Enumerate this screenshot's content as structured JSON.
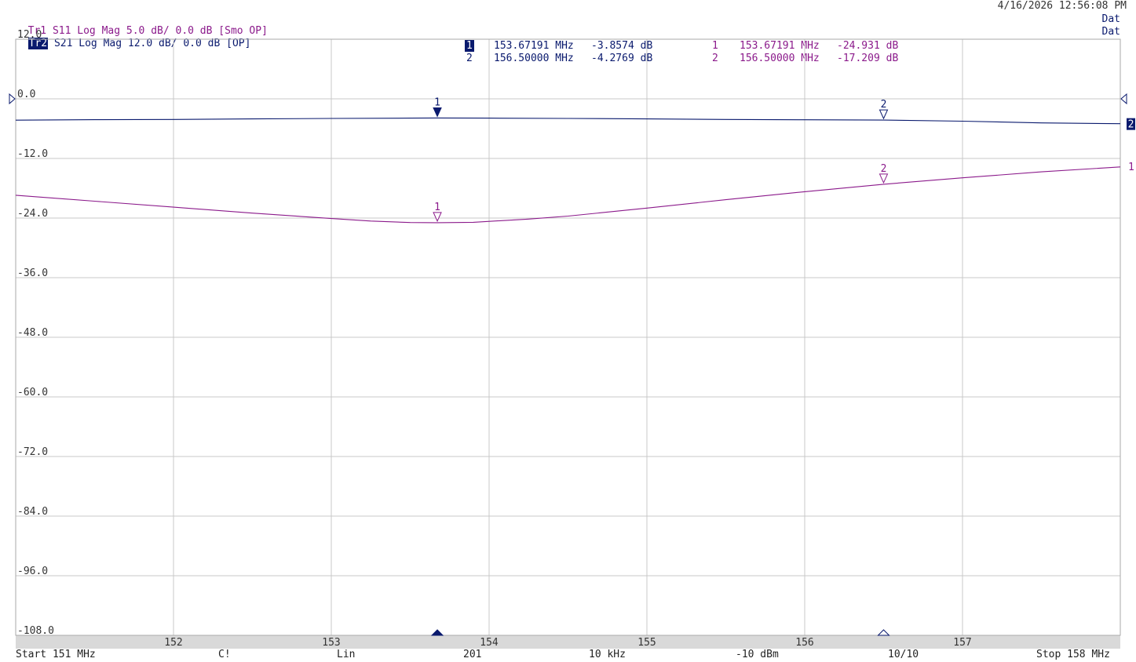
{
  "header": {
    "tr1_label": "Tr1",
    "tr1_text": " S11 Log Mag 5.0 dB/ 0.0 dB [Smo OP]",
    "tr2_label": "Tr2",
    "tr2_text": " S21 Log Mag 12.0 dB/ 0.0 dB [OP]",
    "datetime": "4/16/2026 12:56:08 PM",
    "dat1": "Dat",
    "dat2": "Dat"
  },
  "marker_table": {
    "tr2": [
      {
        "id": "1",
        "freq": "153.67191 MHz",
        "value": "-3.8574 dB"
      },
      {
        "id": "2",
        "freq": "156.50000 MHz",
        "value": "-4.2769 dB"
      }
    ],
    "tr1": [
      {
        "id": "1",
        "freq": "153.67191 MHz",
        "value": "-24.931 dB"
      },
      {
        "id": "2",
        "freq": "156.50000 MHz",
        "value": "-17.209 dB"
      }
    ]
  },
  "footer": {
    "start": "Start 151 MHz",
    "cal": "C!",
    "sweep": "Lin",
    "points": "201",
    "ifbw": "10 kHz",
    "power": "-10 dBm",
    "avg": "10/10",
    "stop": "Stop 158 MHz"
  },
  "colors": {
    "tr1": "#8b1a8b",
    "tr2": "#0a1a6e",
    "grid": "#c8c8c8",
    "axis_band": "#d9d9d9"
  },
  "chart_data": {
    "type": "line",
    "xlim": [
      151,
      158
    ],
    "ylim": [
      -108,
      12
    ],
    "xticks": [
      152,
      153,
      154,
      155,
      156,
      157
    ],
    "yticks": [
      12,
      0,
      -12,
      -24,
      -36,
      -48,
      -60,
      -72,
      -84,
      -96,
      -108
    ],
    "ytick_labels": [
      "12.0",
      "0.0",
      "-12.0",
      "-24.0",
      "-36.0",
      "-48.0",
      "-60.0",
      "-72.0",
      "-84.0",
      "-96.0",
      "-108.0"
    ],
    "grid": true,
    "series": [
      {
        "name": "S21",
        "trace": "Tr2",
        "scale_db_per_div": 12,
        "ref_db": 0,
        "x": [
          151.0,
          151.5,
          152.0,
          152.5,
          153.0,
          153.5,
          153.67,
          154.0,
          154.5,
          155.0,
          155.5,
          156.0,
          156.5,
          157.0,
          157.5,
          158.0
        ],
        "y": [
          -4.3,
          -4.2,
          -4.15,
          -4.05,
          -3.95,
          -3.88,
          -3.86,
          -3.88,
          -3.95,
          -4.05,
          -4.15,
          -4.22,
          -4.28,
          -4.5,
          -4.85,
          -5.0
        ]
      },
      {
        "name": "S11",
        "trace": "Tr1",
        "scale_db_per_div": 5,
        "ref_db": 0,
        "x": [
          151.0,
          151.5,
          152.0,
          152.5,
          153.0,
          153.25,
          153.5,
          153.67,
          153.9,
          154.25,
          154.5,
          155.0,
          155.5,
          156.0,
          156.5,
          157.0,
          157.5,
          158.0
        ],
        "y": [
          -19.4,
          -20.6,
          -21.8,
          -23.0,
          -24.1,
          -24.6,
          -24.9,
          -24.93,
          -24.85,
          -24.2,
          -23.6,
          -22.0,
          -20.3,
          -18.7,
          -17.2,
          -15.9,
          -14.7,
          -13.7
        ]
      }
    ],
    "markers": [
      {
        "trace": "Tr2",
        "id": "1",
        "x": 153.67191,
        "y": -3.8574,
        "active": true
      },
      {
        "trace": "Tr2",
        "id": "2",
        "x": 156.5,
        "y": -4.2769,
        "active": false
      },
      {
        "trace": "Tr1",
        "id": "1",
        "x": 153.67191,
        "y": -24.931,
        "active": false
      },
      {
        "trace": "Tr1",
        "id": "2",
        "x": 156.5,
        "y": -17.209,
        "active": false
      }
    ],
    "trace_end_labels": [
      {
        "trace": "Tr2",
        "text": "2"
      },
      {
        "trace": "Tr1",
        "text": "1"
      }
    ]
  }
}
